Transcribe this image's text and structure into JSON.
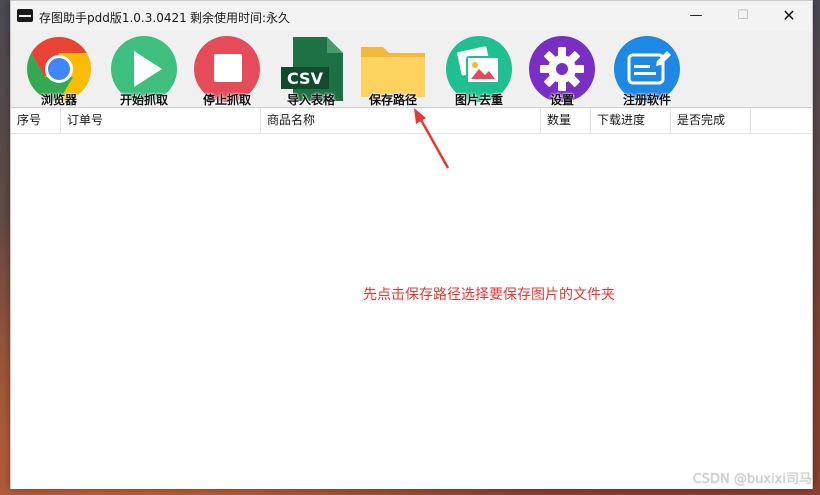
{
  "window": {
    "title": "存图助手pdd版1.0.3.0421",
    "remaining_time": "剩余使用时间:永久",
    "minimize": "—",
    "maximize": "☐",
    "close": "✕"
  },
  "toolbar": {
    "items": [
      {
        "label": "浏览器",
        "icon": "chrome-icon"
      },
      {
        "label": "开始抓取",
        "icon": "play-icon"
      },
      {
        "label": "停止抓取",
        "icon": "stop-icon"
      },
      {
        "label": "导入表格",
        "icon": "csv-icon",
        "icon_text": "CSV"
      },
      {
        "label": "保存路径",
        "icon": "folder-icon"
      },
      {
        "label": "图片去重",
        "icon": "image-icon"
      },
      {
        "label": "设置",
        "icon": "gear-icon"
      },
      {
        "label": "注册软件",
        "icon": "register-icon"
      }
    ]
  },
  "table": {
    "columns": [
      "序号",
      "订单号",
      "商品名称",
      "数量",
      "下载进度",
      "是否完成"
    ],
    "rows": []
  },
  "annotation": {
    "text": "先点击保存路径选择要保存图片的文件夹",
    "color": "#e53935"
  },
  "watermark": "CSDN @buxixi司马"
}
